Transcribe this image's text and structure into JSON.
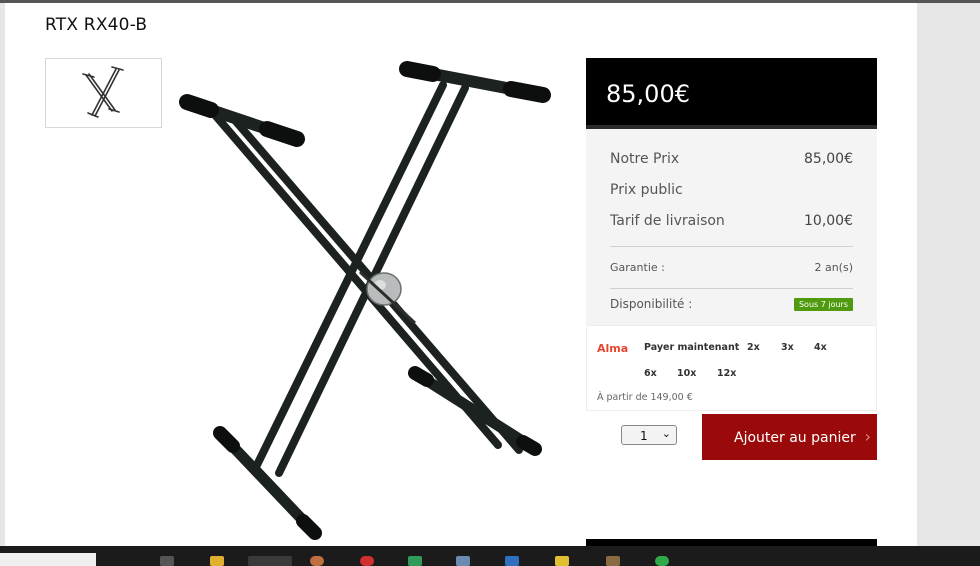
{
  "product": {
    "title": "RTX RX40-B"
  },
  "price_box": {
    "price": "85,00€"
  },
  "details": {
    "our_price_label": "Notre Prix",
    "our_price_value": "85,00€",
    "public_price_label": "Prix public",
    "delivery_label": "Tarif de livraison",
    "delivery_value": "10,00€",
    "warranty_label": "Garantie :",
    "warranty_value": "2 an(s)",
    "availability_label": "Disponibilité :",
    "availability_badge": "Sous 7 jours"
  },
  "alma": {
    "logo": "Alma",
    "options": [
      "Payer maintenant",
      "2x",
      "3x",
      "4x",
      "6x",
      "10x",
      "12x"
    ],
    "from_text": "À partir de 149,00 €"
  },
  "cart": {
    "quantity": "1",
    "add_label": "Ajouter au panier",
    "arrow": "›"
  },
  "colors": {
    "accent_red": "#9b0a0a",
    "badge_green": "#4f9a0f",
    "alma_orange": "#e8462f"
  }
}
